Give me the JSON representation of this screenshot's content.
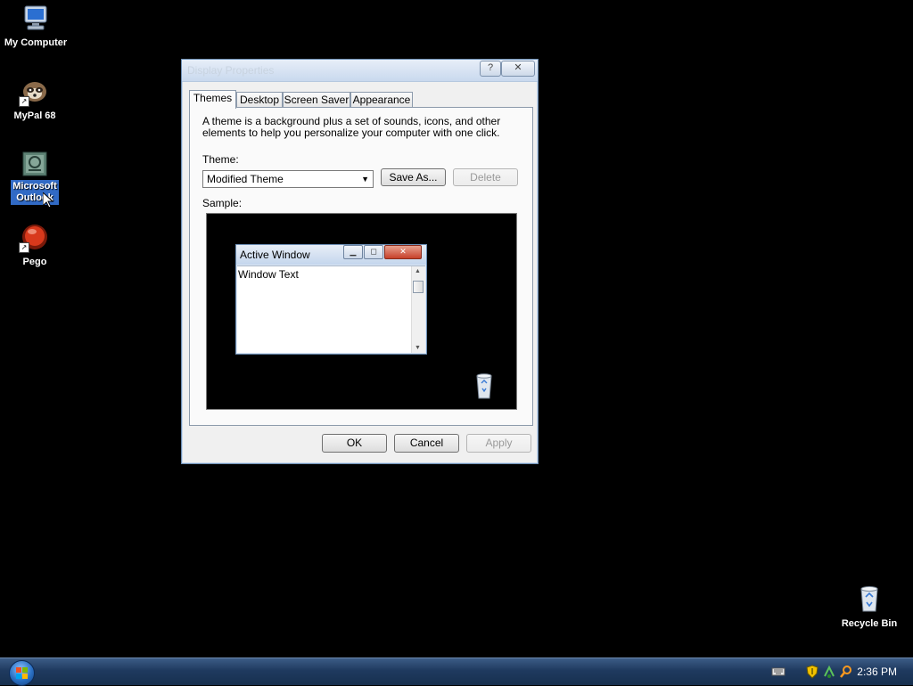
{
  "desktop": {
    "icons": [
      {
        "label": "My Computer",
        "selected": false,
        "icon": "computer-icon"
      },
      {
        "label": "MyPal 68",
        "selected": false,
        "icon": "mypal-icon"
      },
      {
        "label": "Microsoft Outlook",
        "selected": true,
        "icon": "outlook-icon"
      },
      {
        "label": "Pego",
        "selected": false,
        "icon": "pego-icon"
      },
      {
        "label": "Recycle Bin",
        "selected": false,
        "icon": "recycle-bin-icon"
      }
    ]
  },
  "dialog": {
    "title": "Display Properties",
    "help_symbol": "?",
    "close_symbol": "✕",
    "tabs": [
      {
        "label": "Themes",
        "active": true
      },
      {
        "label": "Desktop",
        "active": false
      },
      {
        "label": "Screen Saver",
        "active": false
      },
      {
        "label": "Appearance",
        "active": false
      }
    ],
    "description": "A theme is a background plus a set of sounds, icons, and other elements to help you personalize your computer with one click.",
    "theme_label": "Theme:",
    "theme_selected": "Modified Theme",
    "save_as_label": "Save As...",
    "delete_label": "Delete",
    "sample_label": "Sample:",
    "sample_window": {
      "title": "Active Window",
      "body_text": "Window Text"
    },
    "buttons": {
      "ok": "OK",
      "cancel": "Cancel",
      "apply": "Apply"
    }
  },
  "taskbar": {
    "clock": "2:36 PM",
    "tray_icons": [
      "keyboard-icon",
      "security-shield-icon",
      "network-icon",
      "search-icon"
    ]
  },
  "colors": {
    "desktop_background": "#000000",
    "selection": "#316ac5",
    "taskbar": "#1f3a5f"
  }
}
